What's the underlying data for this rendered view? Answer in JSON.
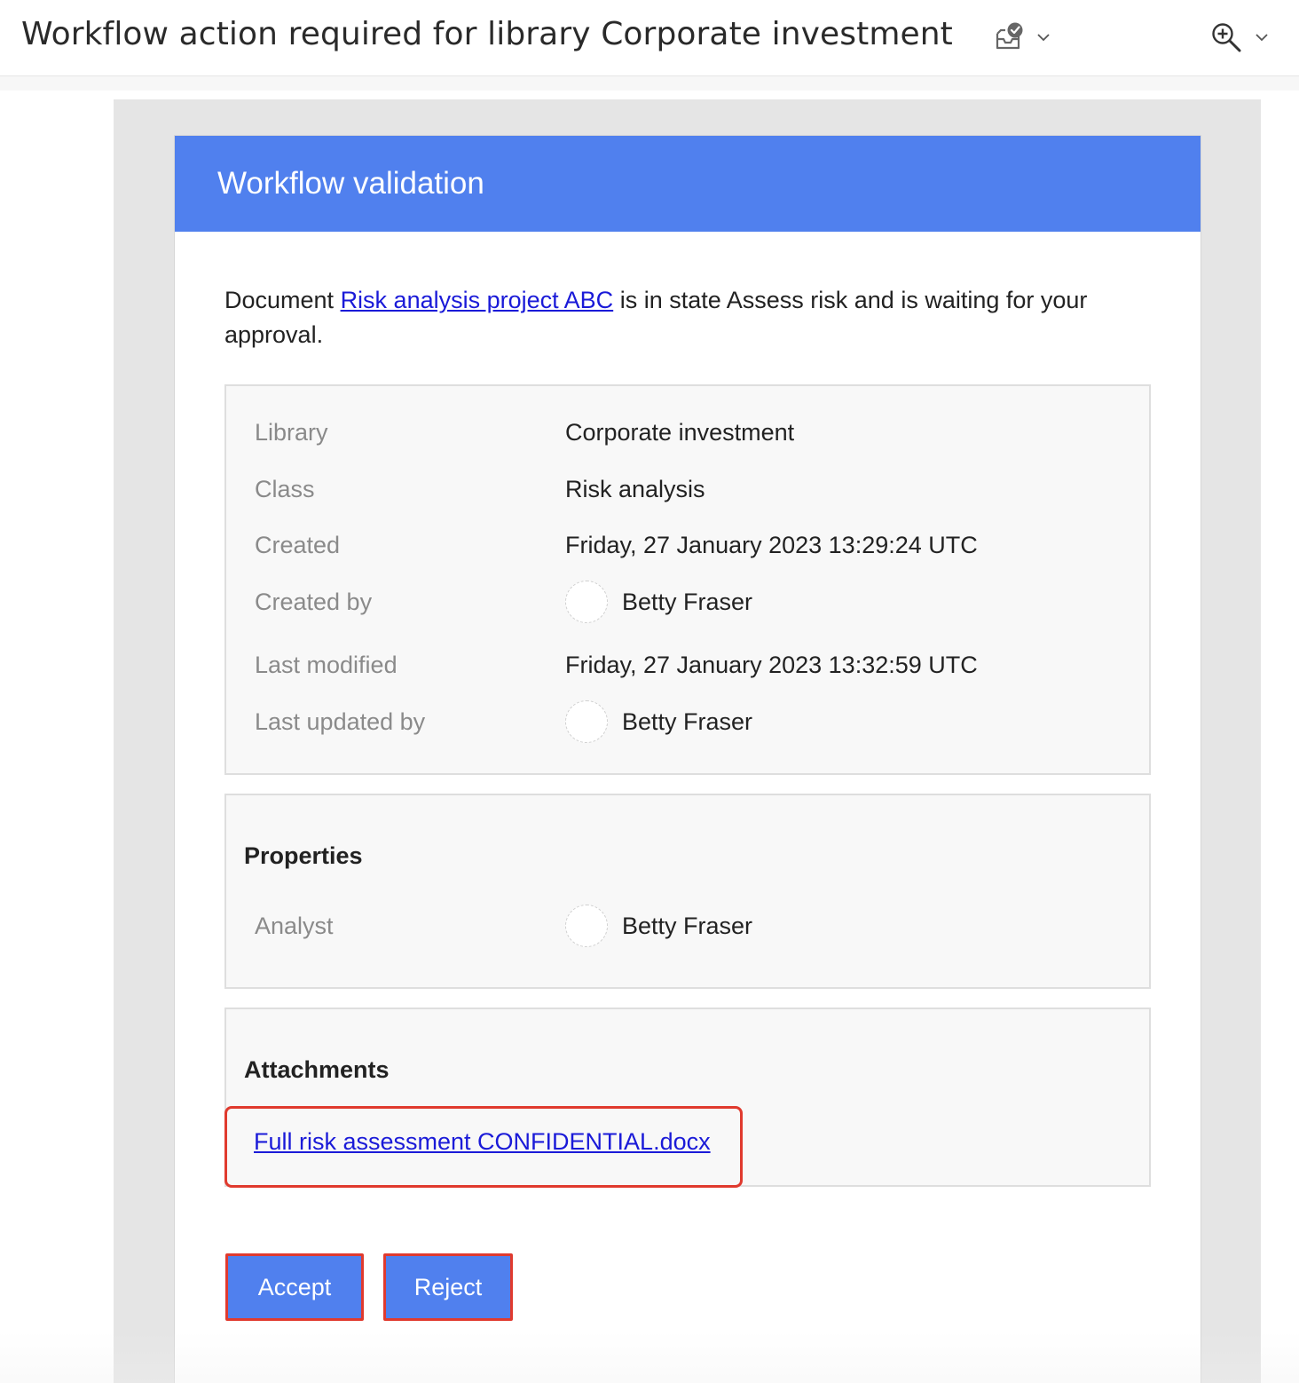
{
  "header": {
    "subject": "Workflow action required for library Corporate investment",
    "action_icon": "approval-inbox-icon",
    "zoom_icon": "zoom-in-icon"
  },
  "card": {
    "title": "Workflow validation",
    "intro": {
      "prefix": "Document ",
      "link_text": "Risk analysis project ABC",
      "suffix": " is in state Assess risk and is waiting for your approval."
    },
    "meta": {
      "library_label": "Library",
      "library_value": "Corporate investment",
      "class_label": "Class",
      "class_value": "Risk analysis",
      "created_label": "Created",
      "created_value": "Friday, 27 January 2023 13:29:24 UTC",
      "created_by_label": "Created by",
      "created_by_value": "Betty Fraser",
      "modified_label": "Last modified",
      "modified_value": "Friday, 27 January 2023 13:32:59 UTC",
      "updated_by_label": "Last updated by",
      "updated_by_value": "Betty Fraser"
    },
    "properties": {
      "title": "Properties",
      "analyst_label": "Analyst",
      "analyst_value": "Betty Fraser"
    },
    "attachments": {
      "title": "Attachments",
      "file": "Full risk assessment CONFIDENTIAL.docx"
    },
    "buttons": {
      "accept": "Accept",
      "reject": "Reject"
    }
  },
  "colors": {
    "accent": "#5080ee",
    "link": "#1a1ad8",
    "highlight": "#e03a2e"
  }
}
